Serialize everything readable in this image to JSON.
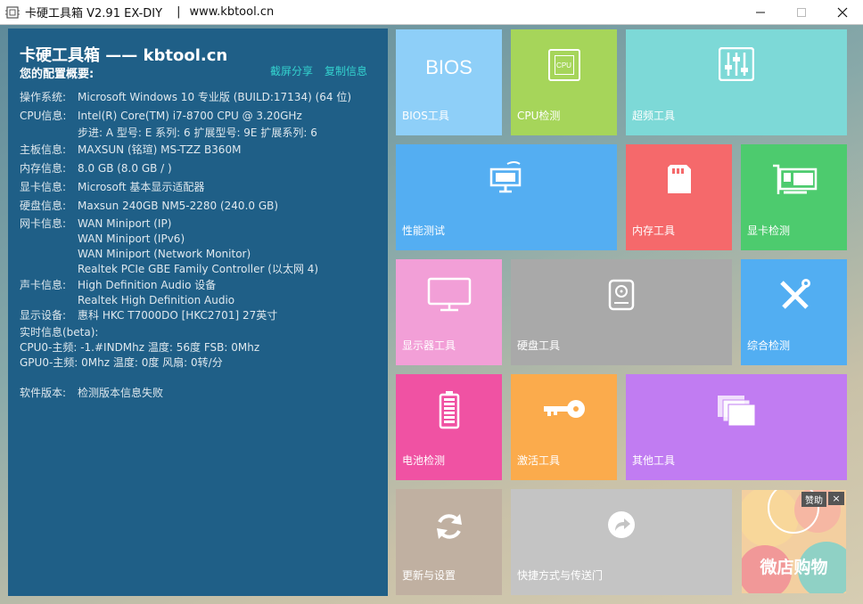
{
  "window": {
    "title": "卡硬工具箱 V2.91  EX-DIY",
    "separator": "|",
    "url": "www.kbtool.cn"
  },
  "info": {
    "brand": "卡硬工具箱 —— kbtool.cn",
    "summary_title": "您的配置概要:",
    "share_link": "截屏分享",
    "copy_link": "复制信息",
    "rows": {
      "os_label": "操作系统:",
      "os_value": "Microsoft Windows 10 专业版 (BUILD:17134) (64 位)",
      "cpu_label": "CPU信息:",
      "cpu_value": "Intel(R) Core(TM) i7-8700 CPU @ 3.20GHz",
      "cpu_detail": "步进: A 型号: E 系列: 6 扩展型号: 9E 扩展系列: 6",
      "board_label": "主板信息:",
      "board_value": "MAXSUN (铭瑄) MS-TZZ B360M",
      "mem_label": "内存信息:",
      "mem_value": "8.0 GB (8.0 GB / )",
      "gpu_label": "显卡信息:",
      "gpu_value": "Microsoft 基本显示适配器",
      "disk_label": "硬盘信息:",
      "disk_value": "Maxsun 240GB NM5-2280 (240.0 GB)",
      "nic_label": "网卡信息:",
      "nic_values": [
        "WAN Miniport (IP)",
        "WAN Miniport (IPv6)",
        "WAN Miniport (Network Monitor)",
        "Realtek PCIe GBE Family Controller (以太网 4)"
      ],
      "sound_label": "声卡信息:",
      "sound_values": [
        "High Definition Audio 设备",
        "Realtek High Definition Audio"
      ],
      "display_label": "显示设备:",
      "display_value": "惠科 HKC T7000DO [HKC2701] 27英寸",
      "realtime_title": "实时信息(beta):",
      "cpu_realtime": "CPU0-主频: -1.#INDMhz 温度: 56度 FSB: 0Mhz",
      "gpu_realtime": "GPU0-主频: 0Mhz 温度: 0度 风扇: 0转/分",
      "version_label": "软件版本:",
      "version_value": "检测版本信息失败"
    }
  },
  "tiles": {
    "bios": {
      "label": "BIOS工具",
      "icon_text": "BIOS",
      "color": "#8ecff8"
    },
    "cpu": {
      "label": "CPU检测",
      "icon_text": "CPU",
      "color": "#a6d55a"
    },
    "overclock": {
      "label": "超频工具",
      "color": "#7dd9d7"
    },
    "benchmark": {
      "label": "性能测试",
      "color": "#54aef2"
    },
    "memory": {
      "label": "内存工具",
      "color": "#f5696b"
    },
    "gpu": {
      "label": "显卡检测",
      "color": "#4dcb6e"
    },
    "monitor": {
      "label": "显示器工具",
      "color": "#f29fd7"
    },
    "disk": {
      "label": "硬盘工具",
      "color": "#a9a9a9"
    },
    "overall": {
      "label": "综合检测",
      "color": "#52aef2"
    },
    "battery": {
      "label": "电池检测",
      "color": "#f052a3"
    },
    "activate": {
      "label": "激活工具",
      "color": "#fbab4c"
    },
    "others": {
      "label": "其他工具",
      "color": "#c17cf2"
    },
    "update": {
      "label": "更新与设置",
      "color": "#c0b0a1"
    },
    "shortcut": {
      "label": "快捷方式与传送门",
      "color": "#c4c4c4"
    }
  },
  "ad": {
    "sponsor": "赞助",
    "close": "×",
    "text": "微店购物"
  }
}
